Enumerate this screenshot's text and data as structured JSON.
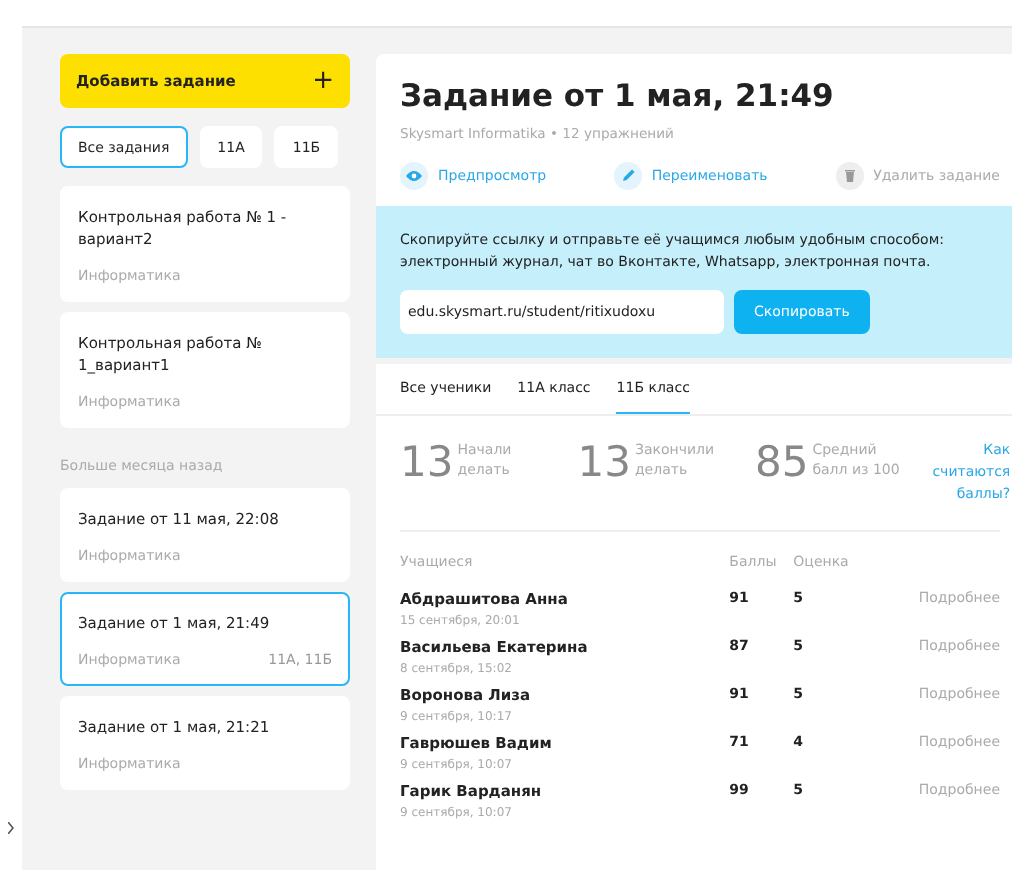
{
  "sidebar": {
    "add_button": {
      "label": "Добавить задание",
      "icon": "+"
    },
    "filters": [
      {
        "label": "Все задания",
        "selected": true
      },
      {
        "label": "11А",
        "selected": false
      },
      {
        "label": "11Б",
        "selected": false
      }
    ],
    "groups": [
      {
        "items": [
          {
            "title": "Контрольная работа № 1 - вариант2",
            "subject": "Информатика",
            "selected": false
          },
          {
            "title": "Контрольная работа № 1_вариант1",
            "subject": "Информатика",
            "selected": false
          }
        ]
      },
      {
        "heading": "Больше месяца назад",
        "items": [
          {
            "title": "Задание от 11 мая, 22:08",
            "subject": "Информатика",
            "selected": false
          },
          {
            "title": "Задание от 1 мая, 21:49",
            "subject": "Информатика",
            "classes": "11А, 11Б",
            "selected": true
          },
          {
            "title": "Задание от 1 мая, 21:21",
            "subject": "Информатика",
            "selected": false
          }
        ]
      }
    ]
  },
  "assignment": {
    "title": "Задание от 1 мая, 21:49",
    "subtitle": "Skysmart Informatika • 12 упражнений",
    "actions": [
      {
        "kind": "preview",
        "label": "Предпросмотр",
        "disabled": false
      },
      {
        "kind": "rename",
        "label": "Переименовать",
        "disabled": false
      },
      {
        "kind": "delete",
        "label": "Удалить задание",
        "disabled": true
      }
    ]
  },
  "share": {
    "text": "Скопируйте ссылку и отправьте её учащимся любым удобным способом: электронный журнал, чат во Вконтакте, Whatsapp, электронная почта.",
    "link": "edu.skysmart.ru/student/ritixudoxu",
    "button": "Скопировать"
  },
  "tabs": [
    {
      "label": "Все ученики",
      "selected": false
    },
    {
      "label": "11А класс",
      "selected": false
    },
    {
      "label": "11Б класс",
      "selected": true
    }
  ],
  "stats": [
    {
      "value": "13",
      "label": "Начали делать"
    },
    {
      "value": "13",
      "label": "Закончили делать"
    },
    {
      "value": "85",
      "label": "Средний балл из 100"
    }
  ],
  "help_link": "Как считаются баллы?",
  "table": {
    "columns": [
      "Учащиеся",
      "Баллы",
      "Оценка"
    ],
    "rows": [
      {
        "name": "Абдрашитова Анна",
        "date": "15 сентября, 20:01",
        "score": "91",
        "grade": "5",
        "details": "Подробнее"
      },
      {
        "name": "Васильева Екатерина",
        "date": "8 сентября, 15:02",
        "score": "87",
        "grade": "5",
        "details": "Подробнее"
      },
      {
        "name": "Воронова Лиза",
        "date": "9 сентября, 10:17",
        "score": "91",
        "grade": "5",
        "details": "Подробнее"
      },
      {
        "name": "Гаврюшев Вадим",
        "date": "9 сентября, 10:07",
        "score": "71",
        "grade": "4",
        "details": "Подробнее"
      },
      {
        "name": "Гарик Варданян",
        "date": "9 сентября, 10:07",
        "score": "99",
        "grade": "5",
        "details": "Подробнее"
      }
    ]
  }
}
